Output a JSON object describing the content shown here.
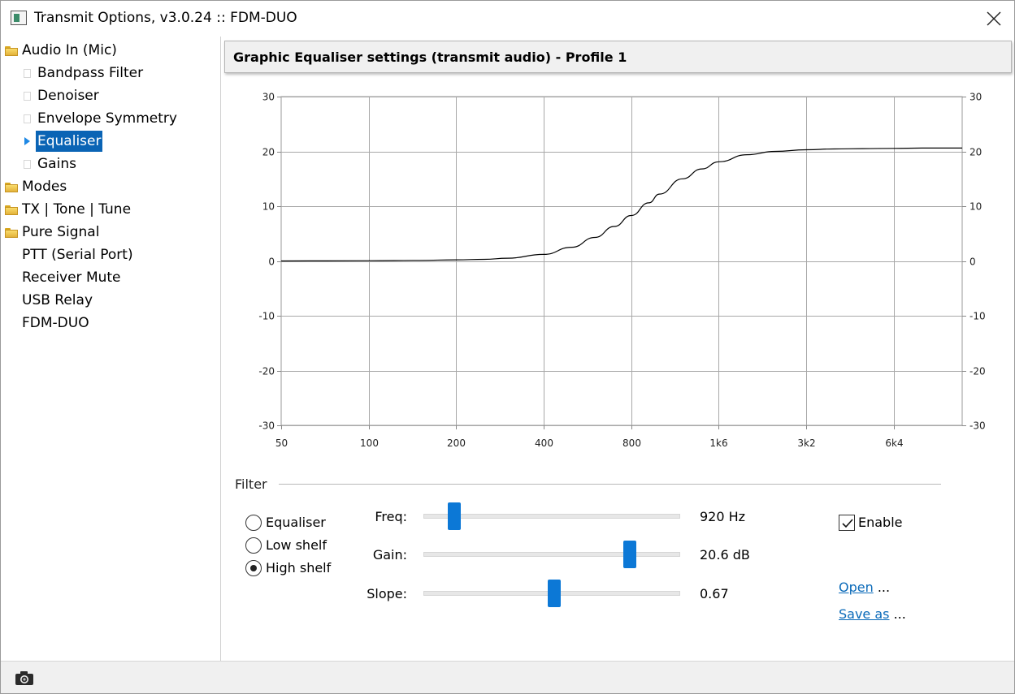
{
  "window": {
    "title": "Transmit Options, v3.0.24 :: FDM-DUO"
  },
  "sidebar": {
    "items": [
      {
        "label": "Audio In (Mic)",
        "type": "folder",
        "level": 0
      },
      {
        "label": "Bandpass Filter",
        "type": "leaf",
        "level": 1
      },
      {
        "label": "Denoiser",
        "type": "leaf",
        "level": 1
      },
      {
        "label": "Envelope Symmetry",
        "type": "leaf",
        "level": 1
      },
      {
        "label": "Equaliser",
        "type": "selected",
        "level": 1
      },
      {
        "label": "Gains",
        "type": "leaf",
        "level": 1
      },
      {
        "label": "Modes",
        "type": "folder",
        "level": 0
      },
      {
        "label": "TX | Tone | Tune",
        "type": "folder",
        "level": 0
      },
      {
        "label": "Pure Signal",
        "type": "folder",
        "level": 0
      },
      {
        "label": "PTT (Serial Port)",
        "type": "plain",
        "level": 0
      },
      {
        "label": "Receiver Mute",
        "type": "plain",
        "level": 0
      },
      {
        "label": "USB Relay",
        "type": "plain",
        "level": 0
      },
      {
        "label": "FDM-DUO",
        "type": "plain",
        "level": 0
      }
    ]
  },
  "header": {
    "title": "Graphic Equaliser settings (transmit audio) - Profile 1"
  },
  "chart_data": {
    "type": "line",
    "title": "",
    "xlabel": "",
    "ylabel": "",
    "x_scale": "log",
    "x_tick_labels": [
      "50",
      "100",
      "200",
      "400",
      "800",
      "1k6",
      "3k2",
      "6k4"
    ],
    "x_ticks_hz": [
      50,
      100,
      200,
      400,
      800,
      1600,
      3200,
      6400
    ],
    "xlim_hz": [
      50,
      11000
    ],
    "ylim": [
      -30,
      30
    ],
    "y_ticks": [
      30,
      20,
      10,
      0,
      -10,
      -20,
      -30
    ],
    "y_tick_labels": [
      "30",
      "20",
      "10",
      "0",
      "-10",
      "-20",
      "-30"
    ],
    "grid": true,
    "series": [
      {
        "color": "#000000",
        "x": [
          50,
          100,
          150,
          200,
          250,
          300,
          400,
          500,
          600,
          700,
          800,
          920,
          1000,
          1200,
          1400,
          1600,
          2000,
          2500,
          3200,
          4000,
          5000,
          6400,
          8000,
          11000
        ],
        "y": [
          0.0,
          0.05,
          0.1,
          0.2,
          0.3,
          0.5,
          1.2,
          2.5,
          4.3,
          6.3,
          8.3,
          10.6,
          12.2,
          15.0,
          16.8,
          18.1,
          19.4,
          20.0,
          20.3,
          20.45,
          20.5,
          20.55,
          20.6,
          20.6
        ]
      }
    ]
  },
  "filter": {
    "label": "Filter",
    "radios": [
      {
        "label": "Equaliser",
        "checked": false
      },
      {
        "label": "Low shelf",
        "checked": false
      },
      {
        "label": "High shelf",
        "checked": true
      }
    ],
    "sliders": [
      {
        "label": "Freq:",
        "value": "920 Hz",
        "position": 0.1
      },
      {
        "label": "Gain:",
        "value": "20.6 dB",
        "position": 0.82
      },
      {
        "label": "Slope:",
        "value": "0.67",
        "position": 0.51
      }
    ],
    "enable_label": "Enable",
    "enable_checked": true,
    "open_label": "Open",
    "open_suffix": " ...",
    "saveas_label": "Save as",
    "saveas_suffix": " ..."
  },
  "icons": {
    "close": "close-icon",
    "camera": "camera-icon",
    "folder": "folder-icon",
    "app": "app-icon"
  }
}
